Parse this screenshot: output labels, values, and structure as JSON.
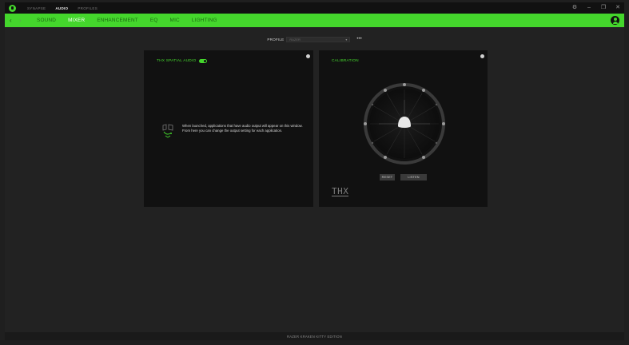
{
  "titlebar": {
    "tabs": [
      {
        "label": "SYNAPSE",
        "active": false
      },
      {
        "label": "AUDIO",
        "active": true
      },
      {
        "label": "PROFILES",
        "active": false
      }
    ],
    "controls": {
      "settings": "⚙",
      "minimize": "–",
      "maximize": "❐",
      "close": "✕"
    }
  },
  "nav": {
    "back": "‹",
    "forward": "›",
    "tabs": [
      {
        "label": "SOUND",
        "active": false
      },
      {
        "label": "MIXER",
        "active": true
      },
      {
        "label": "ENHANCEMENT",
        "active": false
      },
      {
        "label": "EQ",
        "active": false
      },
      {
        "label": "MIC",
        "active": false
      },
      {
        "label": "LIGHTING",
        "active": false
      }
    ]
  },
  "profile": {
    "label": "PROFILE",
    "selected": "RAZER",
    "more": "•••"
  },
  "mixer_panel": {
    "title": "THX SPATIAL AUDIO",
    "toggle_on": true,
    "message": "When launched, applications that have audio output will appear on this window. From here you can change the output setting for each application."
  },
  "calibration_panel": {
    "title": "CALIBRATION",
    "reset_label": "RESET",
    "listen_label": "LISTEN",
    "thx_logo": "THX"
  },
  "status": {
    "text": "RAZER KRAKEN KITTY EDITION"
  },
  "colors": {
    "accent": "#44d62c",
    "panel_bg": "#111111",
    "app_bg": "#222222"
  }
}
